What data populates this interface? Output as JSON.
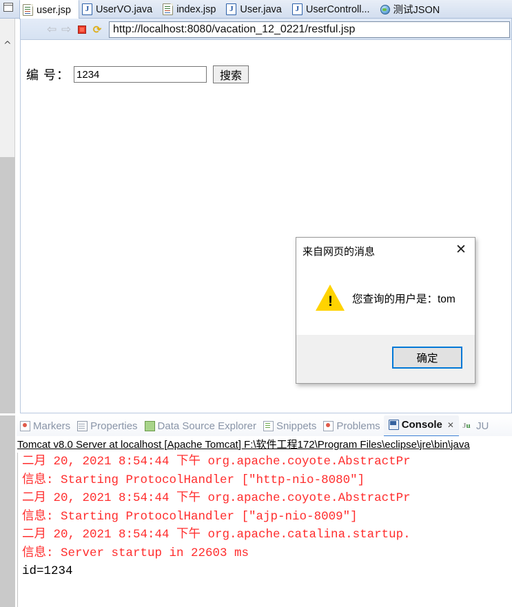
{
  "editor": {
    "view_menu_icon": "panel-menu-icon",
    "tabs": [
      {
        "label": "user.jsp",
        "icon": "jsp-file-icon",
        "type": "jsp",
        "active": true
      },
      {
        "label": "UserVO.java",
        "icon": "java-file-icon",
        "type": "java",
        "active": false
      },
      {
        "label": "index.jsp",
        "icon": "jsp-file-icon",
        "type": "jsp",
        "active": false
      },
      {
        "label": "User.java",
        "icon": "java-file-icon",
        "type": "java",
        "active": false
      },
      {
        "label": "UserControll...",
        "icon": "java-file-icon",
        "type": "java",
        "active": false
      },
      {
        "label": "测试JSON",
        "icon": "globe-icon",
        "type": "web",
        "active": false
      }
    ]
  },
  "browser": {
    "back_icon": "⇦",
    "forward_icon": "⇨",
    "stop_icon": "stop-square-icon",
    "refresh_icon": "⟳",
    "url": "http://localhost:8080/vacation_12_0221/restful.jsp",
    "form": {
      "label": "编 号：",
      "input_value": "1234",
      "input_placeholder": "",
      "button_label": "搜索"
    }
  },
  "dialog": {
    "title": "来自网页的消息",
    "close_icon": "✕",
    "warning_icon": "warning-triangle-icon",
    "warning_glyph": "!",
    "message": "您查询的用户是：tom",
    "ok_label": "确定",
    "accent_color": "#0078d7",
    "warning_color": "#ffd300"
  },
  "bottom_view": {
    "tabs": [
      {
        "label": "Markers",
        "icon": "markers-icon",
        "active": false
      },
      {
        "label": "Properties",
        "icon": "properties-icon",
        "active": false
      },
      {
        "label": "Data Source Explorer",
        "icon": "data-source-icon",
        "active": false
      },
      {
        "label": "Snippets",
        "icon": "snippets-icon",
        "active": false
      },
      {
        "label": "Problems",
        "icon": "problems-icon",
        "active": false
      },
      {
        "label": "Console",
        "icon": "console-icon",
        "active": true,
        "close_icon": "✕"
      },
      {
        "label": "JU",
        "icon": "junit-icon",
        "active": false
      }
    ],
    "launch_config": "Tomcat v8.0 Server at localhost [Apache Tomcat] F:\\软件工程172\\Program Files\\eclipse\\jre\\bin\\java",
    "log_lines": [
      {
        "text": "二月 20, 2021 8:54:44 下午 org.apache.coyote.AbstractPr",
        "color": "red"
      },
      {
        "text": "信息: Starting ProtocolHandler [\"http-nio-8080\"]",
        "color": "red"
      },
      {
        "text": "二月 20, 2021 8:54:44 下午 org.apache.coyote.AbstractPr",
        "color": "red"
      },
      {
        "text": "信息: Starting ProtocolHandler [\"ajp-nio-8009\"]",
        "color": "red"
      },
      {
        "text": "二月 20, 2021 8:54:44 下午 org.apache.catalina.startup.",
        "color": "red"
      },
      {
        "text": "信息: Server startup in 22603 ms",
        "color": "red"
      },
      {
        "text": "id=1234",
        "color": "black"
      }
    ]
  }
}
